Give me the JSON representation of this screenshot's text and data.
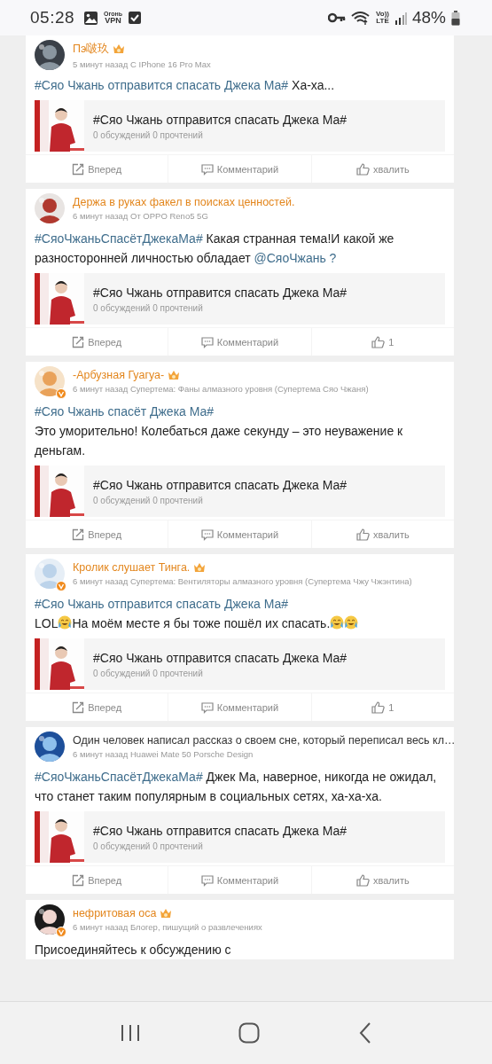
{
  "status_bar": {
    "time": "05:28",
    "vpn_top": "Огонь",
    "vpn_bottom": "VPN",
    "volte_top": "Vo))",
    "volte_bottom": "LTE",
    "battery": "48%"
  },
  "posts": [
    {
      "name": "Пэ啵玖",
      "vip": true,
      "crown": true,
      "verified": false,
      "meta": "5 минут назад С IPhone 16 Pro Max",
      "lines": [
        [
          {
            "kind": "tag",
            "text": "#Сяо Чжань отправится спасать Джека Ма#"
          },
          {
            "kind": "text",
            "text": " Ха-ха..."
          }
        ]
      ],
      "card": {
        "title": "#Сяо Чжань отправится спасать Джека Ма#",
        "stats": "0 обсуждений 0 прочтений"
      },
      "actions": [
        {
          "kind": "forward",
          "label": "Вперед"
        },
        {
          "kind": "comment",
          "label": "Комментарий"
        },
        {
          "kind": "like",
          "label": "хвалить"
        }
      ]
    },
    {
      "name": "Держа в руках факел в поисках ценностей.",
      "vip": true,
      "crown": false,
      "verified": false,
      "meta": "6 минут назад От OPPO Reno5 5G",
      "lines": [
        [
          {
            "kind": "tag",
            "text": "#СяоЧжаньСпасётДжекаМа#"
          },
          {
            "kind": "text",
            "text": " Какая странная тема!И какой же разносторонней личностью обладает "
          },
          {
            "kind": "tag",
            "text": "@СяоЧжань ?"
          }
        ]
      ],
      "card": {
        "title": "#Сяо Чжань отправится спасать Джека Ма#",
        "stats": "0 обсуждений 0 прочтений"
      },
      "actions": [
        {
          "kind": "forward",
          "label": "Вперед"
        },
        {
          "kind": "comment",
          "label": "Комментарий"
        },
        {
          "kind": "like",
          "label": "1"
        }
      ]
    },
    {
      "name": "-Арбузная Гуагуа-",
      "vip": true,
      "crown": true,
      "verified": true,
      "meta": "6 минут назад Супертема: Фаны алмазного уровня (Супертема Сяо Чжаня)",
      "lines": [
        [
          {
            "kind": "tag",
            "text": "#Сяо Чжань спасёт Джека Ма#"
          }
        ],
        [
          {
            "kind": "text",
            "text": "Это уморительно! Колебаться даже секунду – это неуважение к деньгам."
          }
        ]
      ],
      "card": {
        "title": "#Сяо Чжань отправится спасать Джека Ма#",
        "stats": "0 обсуждений 0 прочтений"
      },
      "actions": [
        {
          "kind": "forward",
          "label": "Вперед"
        },
        {
          "kind": "comment",
          "label": "Комментарий"
        },
        {
          "kind": "like",
          "label": "хвалить"
        }
      ]
    },
    {
      "name": "Кролик слушает Тинга.",
      "vip": true,
      "crown": true,
      "verified": true,
      "meta": "6 минут назад Супертема: Вентиляторы алмазного уровня (Супертема Чжу Чжэнтина)",
      "lines": [
        [
          {
            "kind": "tag",
            "text": "#Сяо Чжань отправится спасать Джека Ма#"
          }
        ],
        [
          {
            "kind": "text",
            "text": "LOL"
          },
          {
            "kind": "emoji"
          },
          {
            "kind": "text",
            "text": "На моём месте я бы тоже пошёл их спасать."
          },
          {
            "kind": "emoji"
          },
          {
            "kind": "emoji"
          }
        ]
      ],
      "card": {
        "title": "#Сяо Чжань отправится спасать Джека Ма#",
        "stats": "0 обсуждений 0 прочтений"
      },
      "actions": [
        {
          "kind": "forward",
          "label": "Вперед"
        },
        {
          "kind": "comment",
          "label": "Комментарий"
        },
        {
          "kind": "like",
          "label": "1"
        }
      ]
    },
    {
      "name": "Один человек написал рассказ о своем сне, который переписал весь кл…",
      "vip": false,
      "crown": false,
      "verified": false,
      "meta": "6 минут назад Huawei Mate 50 Porsche Design",
      "lines": [
        [
          {
            "kind": "tag",
            "text": "#СяоЧжаньСпасётДжекаМа#"
          },
          {
            "kind": "text",
            "text": " Джек Ма, наверное, никогда не ожидал, что станет таким популярным в социальных сетях, ха-ха-ха."
          }
        ]
      ],
      "card": {
        "title": "#Сяо Чжань отправится спасать Джека Ма#",
        "stats": "0 обсуждений 0 прочтений"
      },
      "actions": [
        {
          "kind": "forward",
          "label": "Вперед"
        },
        {
          "kind": "comment",
          "label": "Комментарий"
        },
        {
          "kind": "like",
          "label": "хвалить"
        }
      ]
    },
    {
      "name": "нефритовая оса",
      "vip": true,
      "crown": true,
      "verified": true,
      "meta": "6 минут назад Блогер, пишущий о развлечениях",
      "lines": [
        [
          {
            "kind": "text",
            "text": "Присоединяйтесь к обсуждению с"
          }
        ]
      ]
    }
  ]
}
